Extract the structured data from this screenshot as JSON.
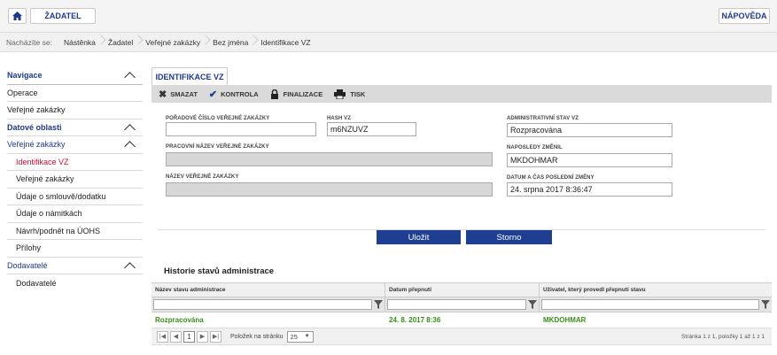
{
  "header": {
    "home_icon": "home-icon",
    "user_label": "ŽADATEL",
    "help_label": "NÁPOVĚDA"
  },
  "breadcrumb": {
    "prefix": "Nacházíte se:",
    "items": [
      "Nástěnka",
      "Žadatel",
      "Veřejné zakázky",
      "Bez jména",
      "Identifikace VZ"
    ]
  },
  "nav": {
    "navigace": "Navigace",
    "operace": "Operace",
    "verejne_zakazky": "Veřejné zakázky",
    "datove_oblasti": "Datové oblasti",
    "vz_group": "Veřejné zakázky",
    "vz_items": [
      "Identifikace VZ",
      "Veřejné zakázky",
      "Údaje o smlouvě/dodatku",
      "Údaje o námitkách",
      "Návrh/podnět na ÚOHS",
      "Přílohy"
    ],
    "dodavatele_group": "Dodavatelé",
    "dodavatele_item": "Dodavatelé"
  },
  "main": {
    "tab_label": "IDENTIFIKACE VZ",
    "toolbar": {
      "delete": "SMAZAT",
      "check": "KONTROLA",
      "finalize": "FINALIZACE",
      "print": "TISK"
    },
    "form": {
      "poradove_label": "POŘADOVÉ ČÍSLO VEŘEJNÉ ZAKÁZKY",
      "poradove_value": "",
      "hash_label": "HASH VZ",
      "hash_value": "m6NZUVZ",
      "admin_stav_label": "ADMINISTRATIVNÍ STAV VZ",
      "admin_stav_value": "Rozpracována",
      "pracovni_label": "PRACOVNÍ NÁZEV VEŘEJNÉ ZAKÁZKY",
      "pracovni_value": "",
      "naposledy_label": "NAPOSLEDY ZMĚNIL",
      "naposledy_value": "MKDOHMAR",
      "nazev_label": "NÁZEV VEŘEJNÉ ZAKÁZKY",
      "nazev_value": "",
      "datum_label": "DATUM A ČAS POSLEDNÍ ZMĚNY",
      "datum_value": "24. srpna 2017 8:36:47"
    },
    "save_label": "Uložit",
    "cancel_label": "Storno",
    "history": {
      "title": "Historie stavů administrace",
      "columns": [
        "Název stavu administrace",
        "Datum přepnutí",
        "Uživatel, který provedl přepnutí stavu"
      ],
      "rows": [
        [
          "Rozpracována",
          "24. 8. 2017 8:36",
          "MKDOHMAR"
        ]
      ],
      "pager": {
        "current_page": "1",
        "per_page_label": "Položek na stránku",
        "per_page_value": "25",
        "info": "Stránka 1 z 1, položky 1 až 1 z 1"
      }
    }
  }
}
